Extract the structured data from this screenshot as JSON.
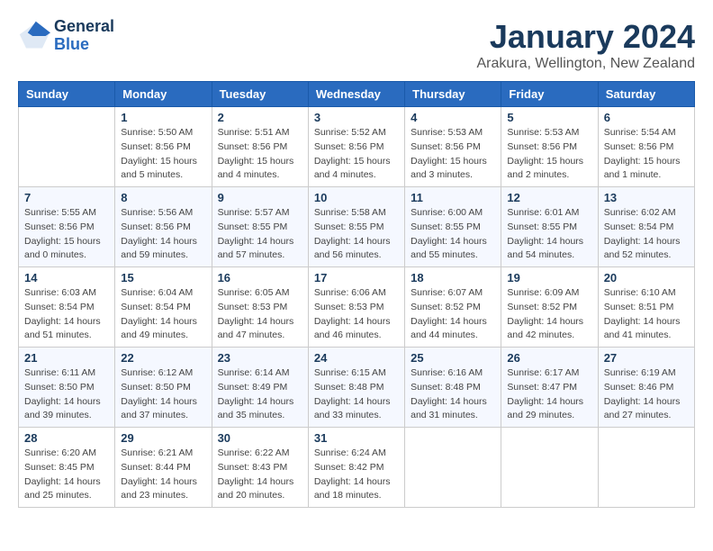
{
  "header": {
    "logo_general": "General",
    "logo_blue": "Blue",
    "month": "January 2024",
    "location": "Arakura, Wellington, New Zealand"
  },
  "days_of_week": [
    "Sunday",
    "Monday",
    "Tuesday",
    "Wednesday",
    "Thursday",
    "Friday",
    "Saturday"
  ],
  "weeks": [
    [
      {
        "day": "",
        "sunrise": "",
        "sunset": "",
        "daylight": ""
      },
      {
        "day": "1",
        "sunrise": "Sunrise: 5:50 AM",
        "sunset": "Sunset: 8:56 PM",
        "daylight": "Daylight: 15 hours and 5 minutes."
      },
      {
        "day": "2",
        "sunrise": "Sunrise: 5:51 AM",
        "sunset": "Sunset: 8:56 PM",
        "daylight": "Daylight: 15 hours and 4 minutes."
      },
      {
        "day": "3",
        "sunrise": "Sunrise: 5:52 AM",
        "sunset": "Sunset: 8:56 PM",
        "daylight": "Daylight: 15 hours and 4 minutes."
      },
      {
        "day": "4",
        "sunrise": "Sunrise: 5:53 AM",
        "sunset": "Sunset: 8:56 PM",
        "daylight": "Daylight: 15 hours and 3 minutes."
      },
      {
        "day": "5",
        "sunrise": "Sunrise: 5:53 AM",
        "sunset": "Sunset: 8:56 PM",
        "daylight": "Daylight: 15 hours and 2 minutes."
      },
      {
        "day": "6",
        "sunrise": "Sunrise: 5:54 AM",
        "sunset": "Sunset: 8:56 PM",
        "daylight": "Daylight: 15 hours and 1 minute."
      }
    ],
    [
      {
        "day": "7",
        "sunrise": "Sunrise: 5:55 AM",
        "sunset": "Sunset: 8:56 PM",
        "daylight": "Daylight: 15 hours and 0 minutes."
      },
      {
        "day": "8",
        "sunrise": "Sunrise: 5:56 AM",
        "sunset": "Sunset: 8:56 PM",
        "daylight": "Daylight: 14 hours and 59 minutes."
      },
      {
        "day": "9",
        "sunrise": "Sunrise: 5:57 AM",
        "sunset": "Sunset: 8:55 PM",
        "daylight": "Daylight: 14 hours and 57 minutes."
      },
      {
        "day": "10",
        "sunrise": "Sunrise: 5:58 AM",
        "sunset": "Sunset: 8:55 PM",
        "daylight": "Daylight: 14 hours and 56 minutes."
      },
      {
        "day": "11",
        "sunrise": "Sunrise: 6:00 AM",
        "sunset": "Sunset: 8:55 PM",
        "daylight": "Daylight: 14 hours and 55 minutes."
      },
      {
        "day": "12",
        "sunrise": "Sunrise: 6:01 AM",
        "sunset": "Sunset: 8:55 PM",
        "daylight": "Daylight: 14 hours and 54 minutes."
      },
      {
        "day": "13",
        "sunrise": "Sunrise: 6:02 AM",
        "sunset": "Sunset: 8:54 PM",
        "daylight": "Daylight: 14 hours and 52 minutes."
      }
    ],
    [
      {
        "day": "14",
        "sunrise": "Sunrise: 6:03 AM",
        "sunset": "Sunset: 8:54 PM",
        "daylight": "Daylight: 14 hours and 51 minutes."
      },
      {
        "day": "15",
        "sunrise": "Sunrise: 6:04 AM",
        "sunset": "Sunset: 8:54 PM",
        "daylight": "Daylight: 14 hours and 49 minutes."
      },
      {
        "day": "16",
        "sunrise": "Sunrise: 6:05 AM",
        "sunset": "Sunset: 8:53 PM",
        "daylight": "Daylight: 14 hours and 47 minutes."
      },
      {
        "day": "17",
        "sunrise": "Sunrise: 6:06 AM",
        "sunset": "Sunset: 8:53 PM",
        "daylight": "Daylight: 14 hours and 46 minutes."
      },
      {
        "day": "18",
        "sunrise": "Sunrise: 6:07 AM",
        "sunset": "Sunset: 8:52 PM",
        "daylight": "Daylight: 14 hours and 44 minutes."
      },
      {
        "day": "19",
        "sunrise": "Sunrise: 6:09 AM",
        "sunset": "Sunset: 8:52 PM",
        "daylight": "Daylight: 14 hours and 42 minutes."
      },
      {
        "day": "20",
        "sunrise": "Sunrise: 6:10 AM",
        "sunset": "Sunset: 8:51 PM",
        "daylight": "Daylight: 14 hours and 41 minutes."
      }
    ],
    [
      {
        "day": "21",
        "sunrise": "Sunrise: 6:11 AM",
        "sunset": "Sunset: 8:50 PM",
        "daylight": "Daylight: 14 hours and 39 minutes."
      },
      {
        "day": "22",
        "sunrise": "Sunrise: 6:12 AM",
        "sunset": "Sunset: 8:50 PM",
        "daylight": "Daylight: 14 hours and 37 minutes."
      },
      {
        "day": "23",
        "sunrise": "Sunrise: 6:14 AM",
        "sunset": "Sunset: 8:49 PM",
        "daylight": "Daylight: 14 hours and 35 minutes."
      },
      {
        "day": "24",
        "sunrise": "Sunrise: 6:15 AM",
        "sunset": "Sunset: 8:48 PM",
        "daylight": "Daylight: 14 hours and 33 minutes."
      },
      {
        "day": "25",
        "sunrise": "Sunrise: 6:16 AM",
        "sunset": "Sunset: 8:48 PM",
        "daylight": "Daylight: 14 hours and 31 minutes."
      },
      {
        "day": "26",
        "sunrise": "Sunrise: 6:17 AM",
        "sunset": "Sunset: 8:47 PM",
        "daylight": "Daylight: 14 hours and 29 minutes."
      },
      {
        "day": "27",
        "sunrise": "Sunrise: 6:19 AM",
        "sunset": "Sunset: 8:46 PM",
        "daylight": "Daylight: 14 hours and 27 minutes."
      }
    ],
    [
      {
        "day": "28",
        "sunrise": "Sunrise: 6:20 AM",
        "sunset": "Sunset: 8:45 PM",
        "daylight": "Daylight: 14 hours and 25 minutes."
      },
      {
        "day": "29",
        "sunrise": "Sunrise: 6:21 AM",
        "sunset": "Sunset: 8:44 PM",
        "daylight": "Daylight: 14 hours and 23 minutes."
      },
      {
        "day": "30",
        "sunrise": "Sunrise: 6:22 AM",
        "sunset": "Sunset: 8:43 PM",
        "daylight": "Daylight: 14 hours and 20 minutes."
      },
      {
        "day": "31",
        "sunrise": "Sunrise: 6:24 AM",
        "sunset": "Sunset: 8:42 PM",
        "daylight": "Daylight: 14 hours and 18 minutes."
      },
      {
        "day": "",
        "sunrise": "",
        "sunset": "",
        "daylight": ""
      },
      {
        "day": "",
        "sunrise": "",
        "sunset": "",
        "daylight": ""
      },
      {
        "day": "",
        "sunrise": "",
        "sunset": "",
        "daylight": ""
      }
    ]
  ]
}
